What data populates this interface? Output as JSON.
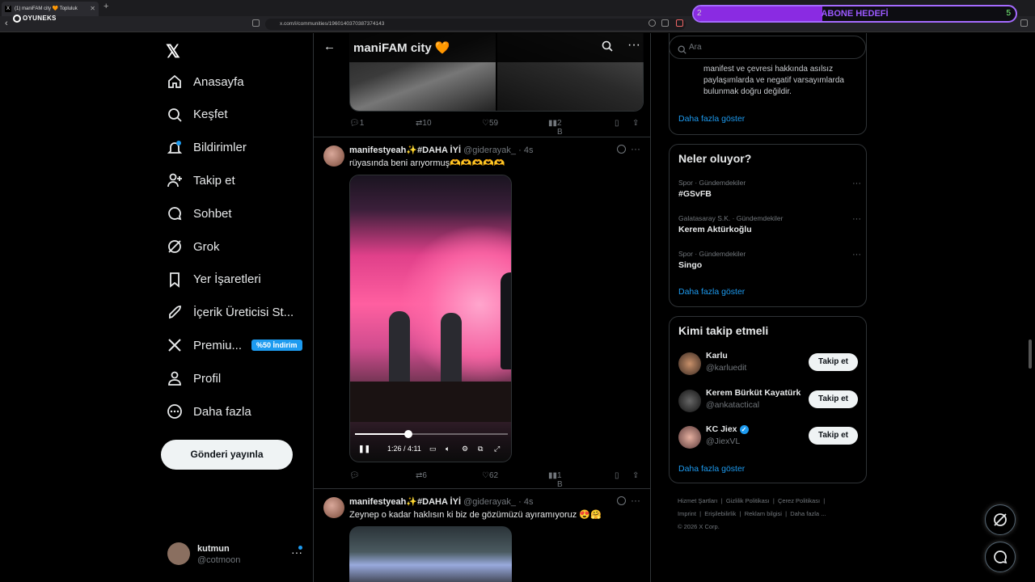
{
  "browser": {
    "tab_title": "(1) maniFAM city 🧡 Topluluk",
    "url": "x.com/i/communities/1960140370387374143",
    "overlay_logo": "OYUNEKS",
    "goal_bar": {
      "label": "ABONE HEDEFİ",
      "current": "2",
      "target": "5",
      "fraction": 0.4
    }
  },
  "sidebar": {
    "items": [
      {
        "label": "Anasayfa",
        "icon": "home-icon"
      },
      {
        "label": "Keşfet",
        "icon": "search-icon"
      },
      {
        "label": "Bildirimler",
        "icon": "bell-icon"
      },
      {
        "label": "Takip et",
        "icon": "add-user-icon"
      },
      {
        "label": "Sohbet",
        "icon": "chat-icon"
      },
      {
        "label": "Grok",
        "icon": "grok-icon"
      },
      {
        "label": "Yer İşaretleri",
        "icon": "bookmark-icon"
      },
      {
        "label": "İçerik Üreticisi St...",
        "icon": "rocket-icon"
      },
      {
        "label": "Premiu...",
        "icon": "x-icon"
      },
      {
        "label": "Profil",
        "icon": "person-icon"
      },
      {
        "label": "Daha fazla",
        "icon": "more-circle-icon"
      }
    ],
    "premium_badge": "%50 İndirim",
    "post_button": "Gönderi yayınla",
    "account": {
      "name": "kutmun",
      "handle": "@cotmoon"
    }
  },
  "main": {
    "title": "maniFAM city",
    "title_emoji": "🧡",
    "tweet0_actions": {
      "replies": "1",
      "reposts": "10",
      "likes": "59",
      "views": "2 B"
    },
    "tweets": [
      {
        "name": "manifestyeah✨#DAHA İYİ",
        "handle": "@giderayak_",
        "time": "· 4s",
        "text": "rüyasında beni arıyormuş🫶🫶🫶🫶🫶",
        "video_time": "1:26 / 4:11",
        "video_progress": 0.35,
        "actions": {
          "replies": "",
          "reposts": "6",
          "likes": "62",
          "views": "1 B"
        }
      },
      {
        "name": "manifestyeah✨#DAHA İYİ",
        "handle": "@giderayak_",
        "time": "· 4s",
        "text": "Zeynep o kadar haklısın ki biz de gözümüzü ayıramıyoruz 😍🤗"
      }
    ]
  },
  "right": {
    "search_placeholder": "Ara",
    "rules_text": "manifest ve çevresi hakkında asılsız paylaşımlarda ve negatif varsayımlarda bulunmak doğru değildir.",
    "show_more": "Daha fazla göster",
    "trends_title": "Neler oluyor?",
    "trends": [
      {
        "category": "Spor · Gündemdekiler",
        "name": "#GSvFB"
      },
      {
        "category": "Galatasaray S.K. · Gündemdekiler",
        "name": "Kerem Aktürkoğlu"
      },
      {
        "category": "Spor · Gündemdekiler",
        "name": "Singo"
      }
    ],
    "who_title": "Kimi takip etmeli",
    "who": [
      {
        "name": "Karlu",
        "handle": "@karluedit",
        "button": "Takip et",
        "verified": false
      },
      {
        "name": "Kerem Bürküt Kayatürk",
        "handle": "@ankatactical",
        "button": "Takip et",
        "verified": false
      },
      {
        "name": "KC Jiex",
        "handle": "@JiexVL",
        "button": "Takip et",
        "verified": true
      }
    ],
    "footer": {
      "row1": [
        "Hizmet Şartları",
        "Gizlilik Politikası",
        "Çerez Politikası"
      ],
      "row2": [
        "Imprint",
        "Erişilebilirlik",
        "Reklam bilgisi",
        "Daha fazla ..."
      ],
      "copyright": "© 2026 X Corp."
    }
  }
}
